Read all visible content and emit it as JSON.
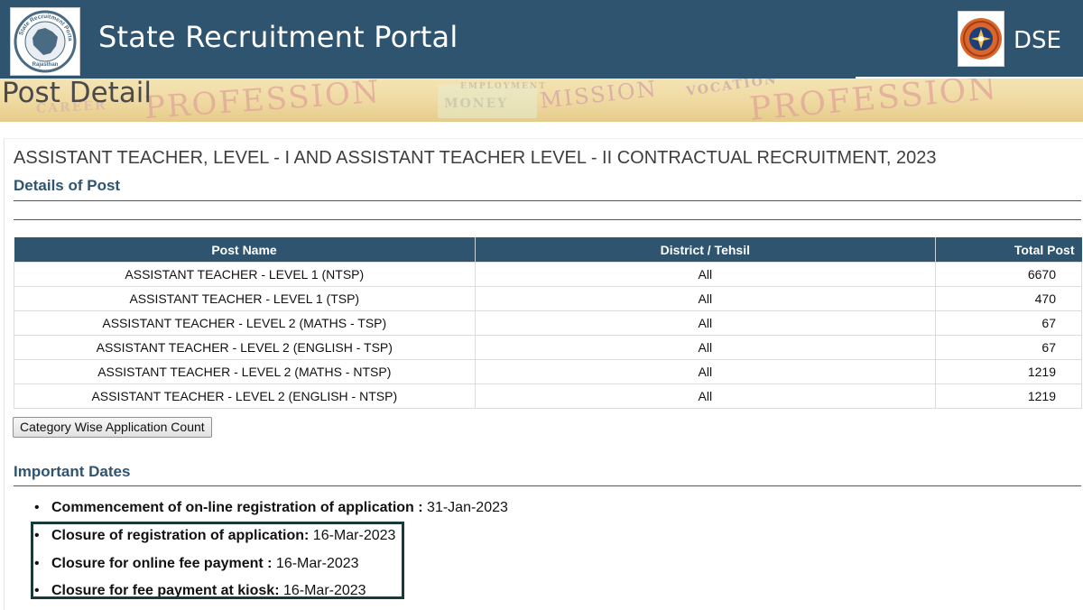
{
  "header": {
    "site_title": "State Recruitment Portal",
    "right_label": "DSE",
    "logo_left_icon": "rajasthan-map-seal-icon",
    "logo_left_text_top": "State Recruitment Portal",
    "logo_left_text_bottom": "Rajasthan",
    "logo_right_icon": "dse-emblem-icon"
  },
  "banner": {
    "heading": "Post Detail",
    "watermarks": [
      "PROFESSION",
      "PROFESSION",
      "MISSION",
      "MONEY",
      "VOCATION",
      "CAREER",
      "EMPLOYMENT"
    ]
  },
  "post": {
    "title": "ASSISTANT TEACHER, LEVEL - I AND ASSISTANT TEACHER LEVEL - II CONTRACTUAL RECRUITMENT, 2023",
    "details_heading": "Details of Post"
  },
  "table": {
    "headers": [
      "Post Name",
      "District / Tehsil",
      "Total Post"
    ],
    "rows": [
      [
        "ASSISTANT TEACHER - LEVEL 1 (NTSP)",
        "All",
        "6670"
      ],
      [
        "ASSISTANT TEACHER - LEVEL 1 (TSP)",
        "All",
        "470"
      ],
      [
        "ASSISTANT TEACHER - LEVEL 2 (MATHS - TSP)",
        "All",
        "67"
      ],
      [
        "ASSISTANT TEACHER - LEVEL 2 (ENGLISH - TSP)",
        "All",
        "67"
      ],
      [
        "ASSISTANT TEACHER - LEVEL 2 (MATHS - NTSP)",
        "All",
        "1219"
      ],
      [
        "ASSISTANT TEACHER - LEVEL 2 (ENGLISH - NTSP)",
        "All",
        "1219"
      ]
    ]
  },
  "button": {
    "category_count_label": "Category Wise Application Count"
  },
  "dates": {
    "heading": "Important Dates",
    "items": [
      {
        "label": "Commencement of on-line registration of application :",
        "value": " 31-Jan-2023"
      },
      {
        "label": "Closure of registration of application:",
        "value": " 16-Mar-2023"
      },
      {
        "label": "Closure for online fee payment :",
        "value": " 16-Mar-2023"
      },
      {
        "label": "Closure for fee payment at kiosk:",
        "value": " 16-Mar-2023"
      }
    ]
  },
  "colors": {
    "header_bg": "#2f5470",
    "accent_heading": "#2f5470",
    "highlight_border": "#173b3a"
  }
}
